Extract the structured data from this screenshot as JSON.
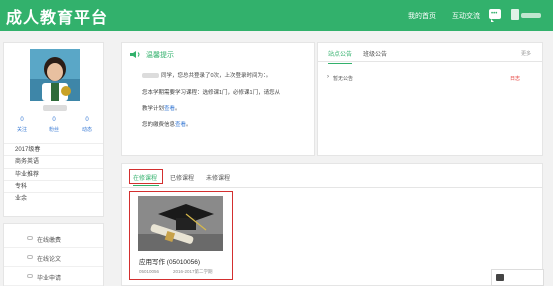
{
  "header": {
    "title": "成人教育平台",
    "nav": {
      "home": "我的首页",
      "interact": "互动交流"
    },
    "chat_icon": "chat-bubble-icon"
  },
  "profile": {
    "stats": [
      {
        "value": "0",
        "label": "关注"
      },
      {
        "value": "0",
        "label": "粉丝"
      },
      {
        "value": "0",
        "label": "动态"
      }
    ],
    "info": [
      "2017级春",
      "商务英语",
      "毕业推荐",
      "专科",
      "业余"
    ]
  },
  "links": [
    "在线缴费",
    "在线论文",
    "毕业申请"
  ],
  "reminder": {
    "title": "温馨提示",
    "line1": "同学，您总共登录了0次，上次登录时间为：。",
    "line2": "您本学期需要学习课程：选修课1门，必修课1门，请您从",
    "line3_prefix": "教学计划",
    "line3_link": "查看",
    "line3_suffix": "。",
    "line4_prefix": "您的缴费信息",
    "line4_link": "查看",
    "line4_suffix": "。"
  },
  "notice": {
    "tabs": [
      "站点公告",
      "班级公告"
    ],
    "more": "更多",
    "row": {
      "arrow": "›",
      "text": "暂无公告",
      "tag": "日志"
    }
  },
  "courses": {
    "tabs": [
      "在修课程",
      "已修课程",
      "未修课程"
    ],
    "card": {
      "title": "应用写作 (05010056)",
      "code": "05010056",
      "term": "2016-2017第二学期"
    }
  },
  "colors": {
    "brand": "#32b16c",
    "highlight": "#d32f2f",
    "link": "#3a7bd5"
  }
}
